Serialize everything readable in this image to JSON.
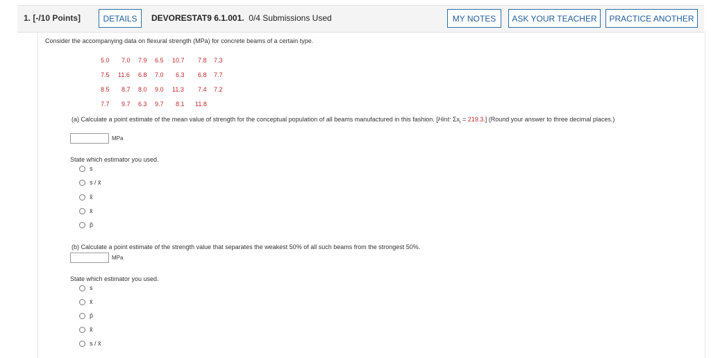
{
  "header": {
    "question_label": "1.  [-/10 Points]",
    "details_label": "DETAILS",
    "code": "DEVORESTAT9 6.1.001.",
    "submissions": "0/4 Submissions Used",
    "my_notes_label": "MY NOTES",
    "ask_teacher_label": "ASK YOUR TEACHER",
    "practice_label": "PRACTICE ANOTHER"
  },
  "prompt": "Consider the accompanying data on flexural strength (MPa) for concrete beams of a certain type.",
  "data_rows": [
    [
      "5.0",
      "7.0",
      "7.9",
      "6.5",
      "10.7",
      "7.8",
      "7.3"
    ],
    [
      "7.5",
      "11.6",
      "6.8",
      "7.0",
      "6.3",
      "6.8",
      "7.7"
    ],
    [
      "8.5",
      "8.7",
      "8.0",
      "9.0",
      "11.3",
      "7.4",
      "7.2"
    ],
    [
      "7.7",
      "9.7",
      "6.3",
      "9.7",
      "8.1",
      "11.8"
    ]
  ],
  "part_a": {
    "text_before": "(a) Calculate a point estimate of the mean value of strength for the conceptual population of all beams manufactured in this fashion. [",
    "hint_label": "Hint:",
    "hint_expr": " Σx",
    "hint_sub": "i",
    "hint_eq": " = ",
    "hint_value": "219.3",
    "text_after": ".] (Round your answer to three decimal places.)",
    "unit": "MPa",
    "answer_value": "",
    "estimator_label": "State which estimator you used.",
    "options": [
      "s",
      "s / x̄",
      "x̃",
      "x̄",
      "p̂"
    ]
  },
  "part_b": {
    "text": "(b) Calculate a point estimate of the strength value that separates the weakest 50% of all such beams from the strongest 50%.",
    "unit": "MPa",
    "answer_value": "",
    "estimator_label": "State which estimator you used.",
    "options": [
      "s",
      "x̄",
      "p̂",
      "x̃",
      "s / x̄"
    ]
  },
  "colors": {
    "accent": "#1f5c99",
    "data_red": "#c0262d"
  }
}
